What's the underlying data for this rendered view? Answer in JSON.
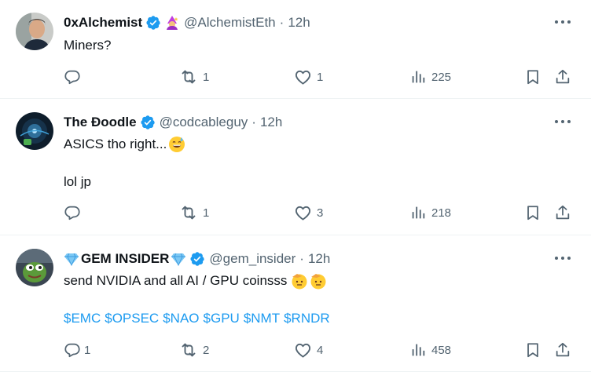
{
  "tweets": [
    {
      "name": "0xAlchemist",
      "handle": "@AlchemistEth",
      "separator": "·",
      "time": "12h",
      "lines": [
        "Miners?"
      ],
      "cashtags": [],
      "replies": "",
      "reposts": "1",
      "likes": "1",
      "views": "225"
    },
    {
      "name": "The Ðoodle",
      "handle": "@codcableguy",
      "separator": "·",
      "time": "12h",
      "lines": [
        "ASICS tho right...",
        "lol jp"
      ],
      "cashtags": [],
      "replies": "",
      "reposts": "1",
      "likes": "3",
      "views": "218"
    },
    {
      "name": "GEM INSIDER",
      "handle": "@gem_insider",
      "separator": "·",
      "time": "12h",
      "lines": [
        "send NVIDIA and all AI / GPU coinsss"
      ],
      "cashtags": [
        "$EMC",
        "$OPSEC",
        "$NAO",
        "$GPU",
        "$NMT",
        "$RNDR"
      ],
      "replies": "1",
      "reposts": "2",
      "likes": "4",
      "views": "458"
    }
  ],
  "icons": {
    "verified": "verified-badge-icon",
    "reply": "reply-icon",
    "repost": "repost-icon",
    "like": "heart-icon",
    "views": "views-chart-icon",
    "bookmark": "bookmark-icon",
    "share": "share-icon",
    "more": "more-dots-icon",
    "mage": "mage-emoji-icon",
    "gem": "gem-emoji-icon",
    "sweat_smile": "sweat-smile-emoji-icon",
    "salute": "saluting-face-emoji-icon"
  },
  "colors": {
    "accent": "#1d9bf0",
    "text": "#0f1419",
    "muted": "#536471",
    "border": "#eff3f4"
  }
}
